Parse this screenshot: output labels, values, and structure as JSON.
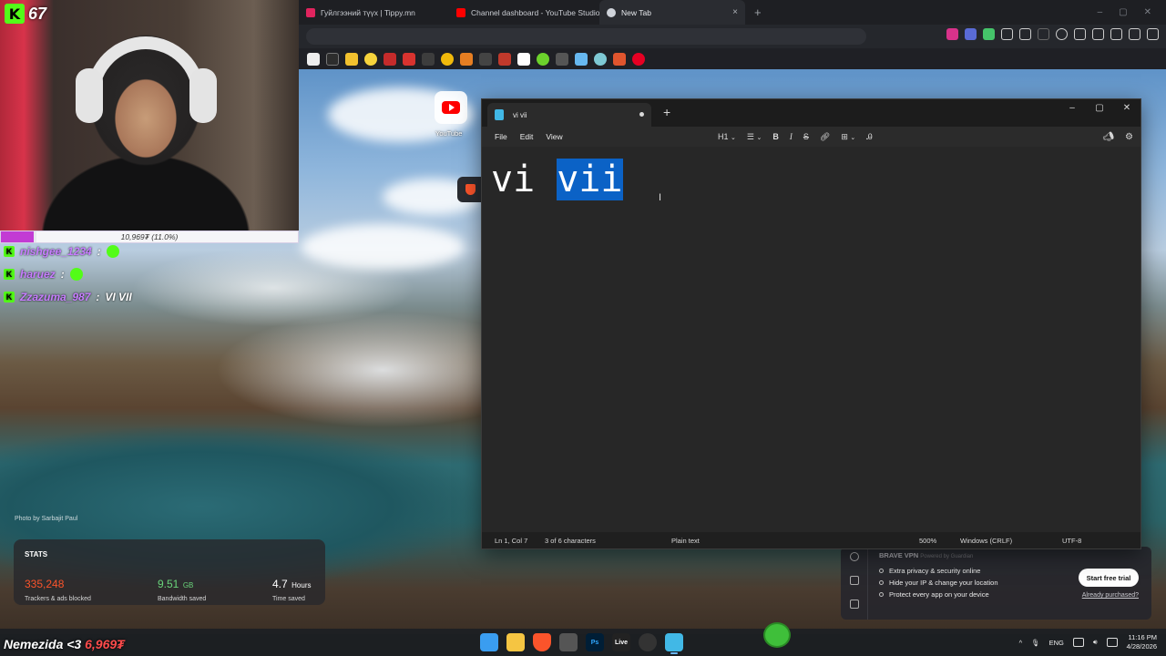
{
  "browser": {
    "tabs": [
      {
        "title": "Гуйлгээний түүх | Tippy.mn",
        "color": "#e0245e",
        "active": false
      },
      {
        "title": "Channel dashboard - YouTube Studio",
        "color": "#ff0000",
        "active": false
      },
      {
        "title": "New Tab",
        "color": "#cfd3da",
        "active": true
      }
    ],
    "close_glyph": "×",
    "new_tab_glyph": "+",
    "win_controls": [
      "–",
      "▢",
      "✕"
    ]
  },
  "stream": {
    "kick_logo": "K",
    "viewer_count": "67",
    "goal_text": "10,969₮ (11.0%)",
    "goal_fraction": 0.11,
    "chat": [
      {
        "user": "nishgee_1234",
        "sep": ":",
        "msg": ""
      },
      {
        "user": "haruez",
        "sep": ":",
        "msg": ""
      },
      {
        "user": "Zzazuma_987",
        "sep": ":",
        "msg": "VI VII"
      }
    ],
    "donor_line": {
      "name": "Nemezida <3",
      "amount": "6,969₮"
    }
  },
  "newtab": {
    "shortcut_label": "YouTube",
    "photo_credit": "Photo by Sarbajit Paul",
    "stats": {
      "title": "STATS",
      "items": [
        {
          "value": "335,248",
          "unit": "",
          "label": "Trackers & ads blocked",
          "color": "#fb542b"
        },
        {
          "value": "9.51",
          "unit": "GB",
          "label": "Bandwidth saved",
          "color": "#6ad47a"
        },
        {
          "value": "4.7",
          "unit": "Hours",
          "label": "Time saved",
          "color": "#ffffff"
        }
      ]
    },
    "vpn": {
      "title": "BRAVE VPN",
      "powered": "Powered by Guardian",
      "lines": [
        "Extra privacy & security online",
        "Hide your IP & change your location",
        "Protect every app on your device"
      ],
      "cta": "Start free trial",
      "link": "Already purchased?"
    }
  },
  "notepad": {
    "tab_title": "vi vii",
    "menu": [
      "File",
      "Edit",
      "View"
    ],
    "heading_select": "H1",
    "format_buttons": {
      "bold": "B",
      "italic": "I",
      "strike": "S"
    },
    "content_plain": "vi ",
    "content_selected": "vii",
    "status": {
      "position": "Ln 1, Col 7",
      "selection": "3 of 6 characters",
      "mode": "Plain text",
      "zoom": "500%",
      "line_ending": "Windows (CRLF)",
      "encoding": "UTF-8"
    }
  },
  "taskbar": {
    "apps": [
      "",
      "",
      "",
      "",
      "Ps",
      "Live",
      "",
      ""
    ],
    "lang": "ENG",
    "time": "11:16 PM",
    "date": "4/28/2026"
  }
}
